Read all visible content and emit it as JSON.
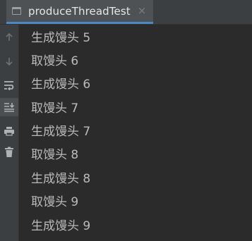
{
  "tab": {
    "title": "produceThreadTest",
    "close_glyph": "×",
    "icon": "console-window-icon"
  },
  "toolbar": {
    "buttons": [
      {
        "name": "up-arrow-icon"
      },
      {
        "name": "down-arrow-icon"
      },
      {
        "name": "soft-wrap-icon"
      },
      {
        "name": "scroll-to-end-icon",
        "active": true
      },
      {
        "name": "print-icon"
      },
      {
        "name": "trash-icon"
      }
    ]
  },
  "console": {
    "lines": [
      "生成馒头 5",
      "取馒头 6",
      "生成馒头 6",
      "取馒头 7",
      "生成馒头 7",
      "取馒头 8",
      "生成馒头 8",
      "取馒头 9",
      "生成馒头 9"
    ]
  },
  "colors": {
    "background": "#2b2b2b",
    "panel": "#3c3f41",
    "text": "#bbbbbb",
    "accent": "#4a88c7"
  }
}
